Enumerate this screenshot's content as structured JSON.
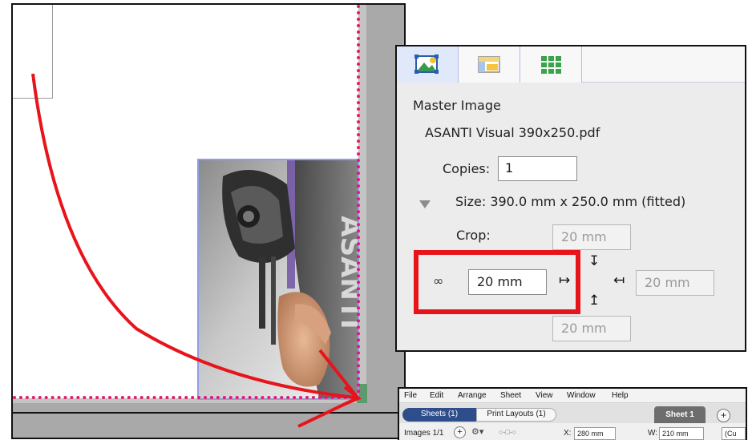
{
  "canvas": {
    "trim_color": "#e8186a",
    "image_frame_color": "#8e9ee8",
    "image_watermark": "ASANTI"
  },
  "panel": {
    "tabs": [
      {
        "icon": "image-layer-icon",
        "selected": true
      },
      {
        "icon": "layout-icon",
        "selected": false
      },
      {
        "icon": "grid-icon",
        "selected": false
      }
    ],
    "heading": "Master Image",
    "file_name": "ASANTI Visual 390x250.pdf",
    "copies_label": "Copies:",
    "copies_value": "1",
    "size_text": "Size: 390.0 mm x 250.0 mm  (fitted)",
    "crop_label": "Crop:",
    "crop": {
      "top": "20 mm",
      "left": "20 mm",
      "right": "20 mm",
      "bottom": "20 mm"
    },
    "link_symbol": "∞",
    "arrows": {
      "left_edge": "↦",
      "right_edge": "↤",
      "top_edge": "↧",
      "bottom_edge": "↥"
    },
    "highlight_color": "#e8141b"
  },
  "app": {
    "menu": [
      "File",
      "Edit",
      "Arrange",
      "Sheet",
      "View",
      "Window",
      "Help"
    ],
    "tabs": {
      "sheets": "Sheets (1)",
      "print_layouts": "Print Layouts (1)"
    },
    "sheet_tab": "Sheet 1",
    "add_symbol": "+",
    "toolbar": {
      "images_count": "Images 1/1",
      "gear": "⚙▾",
      "chain": "○-□-○",
      "x_label": "X:",
      "x_value": "280 mm",
      "w_label": "W:",
      "w_value": "210 mm",
      "unit_dropdown": "(Cu"
    },
    "accent_color": "#2d4e8a"
  },
  "annotation_color": "#e8141b"
}
